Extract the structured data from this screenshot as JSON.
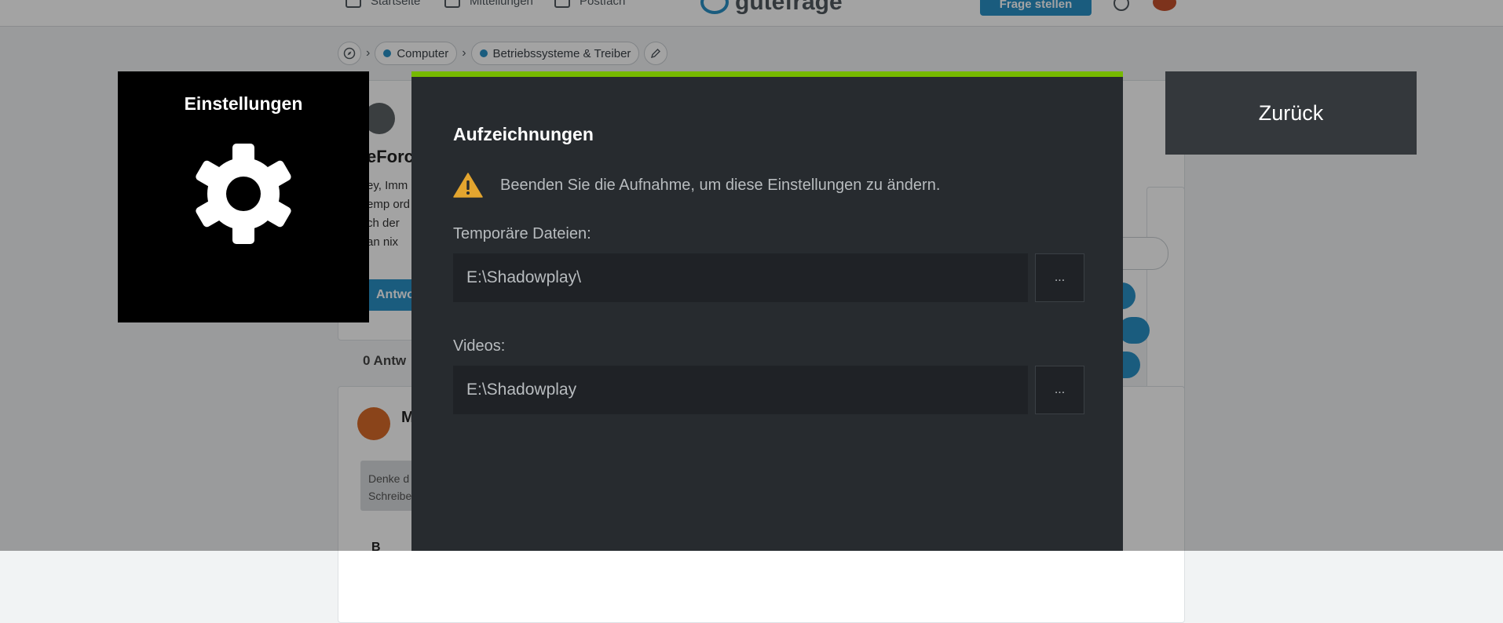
{
  "background": {
    "nav": {
      "home_label": "Startseite",
      "messages_label": "Mitteilungen",
      "mail_label": "Postfach",
      "logo_text": "gutefrage",
      "ask_button": "Frage stellen"
    },
    "breadcrumb": {
      "items": [
        "Computer",
        "Betriebssysteme & Treiber"
      ]
    },
    "question": {
      "title_fragment": "eForc",
      "text_lines": [
        "ey, Imm",
        "emp ord",
        "ch der",
        "an nix"
      ],
      "answer_button": "Antwo"
    },
    "answers_count_fragment": "0 Antw",
    "answer": {
      "author_fragment": "M",
      "comment_lines": [
        "Denke d",
        "Schreibe"
      ],
      "bold_button": "B"
    },
    "colors": {
      "brand": "#2a90c6"
    }
  },
  "overlay": {
    "settings_tile": {
      "title": "Einstellungen",
      "icon": "gear-icon"
    },
    "back_button": "Zurück",
    "panel": {
      "title": "Aufzeichnungen",
      "warning": "Beenden Sie die Aufnahme, um diese Einstellungen zu ändern.",
      "temp_files": {
        "label": "Temporäre Dateien:",
        "value": "E:\\Shadowplay\\",
        "browse": "..."
      },
      "videos": {
        "label": "Videos:",
        "value": "E:\\Shadowplay",
        "browse": "..."
      }
    },
    "colors": {
      "accent": "#76b900",
      "panel_bg": "#272b2f",
      "warning": "#e3a52f"
    }
  }
}
